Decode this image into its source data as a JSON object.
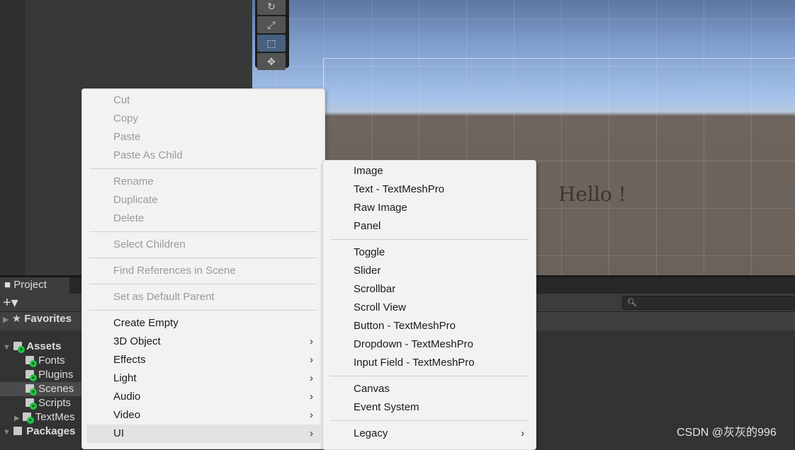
{
  "scene": {
    "canvas_text": "Hello !"
  },
  "project_tab": {
    "label": "Project",
    "add_label": "+▾",
    "search_placeholder": ""
  },
  "tree": [
    {
      "label": "Favorites",
      "kind": "root",
      "icon": "star-icon"
    },
    {
      "label": "Assets",
      "kind": "root",
      "icon": "folder-icon"
    },
    {
      "label": "Fonts",
      "kind": "child"
    },
    {
      "label": "Plugins",
      "kind": "child"
    },
    {
      "label": "Scenes",
      "kind": "child",
      "selected": true
    },
    {
      "label": "Scripts",
      "kind": "child"
    },
    {
      "label": "TextMes",
      "kind": "child"
    },
    {
      "label": "Packages",
      "kind": "root",
      "icon": "folder-icon"
    }
  ],
  "context_menu": [
    {
      "label": "Cut",
      "disabled": true
    },
    {
      "label": "Copy",
      "disabled": true
    },
    {
      "label": "Paste",
      "disabled": true
    },
    {
      "label": "Paste As Child",
      "disabled": true
    },
    {
      "sep": true
    },
    {
      "label": "Rename",
      "disabled": true
    },
    {
      "label": "Duplicate",
      "disabled": true
    },
    {
      "label": "Delete",
      "disabled": true
    },
    {
      "sep": true
    },
    {
      "label": "Select Children",
      "disabled": true
    },
    {
      "sep": true
    },
    {
      "label": "Find References in Scene",
      "disabled": true
    },
    {
      "sep": true
    },
    {
      "label": "Set as Default Parent",
      "disabled": true
    },
    {
      "sep": true
    },
    {
      "label": "Create Empty"
    },
    {
      "label": "3D Object",
      "submenu": true
    },
    {
      "label": "Effects",
      "submenu": true
    },
    {
      "label": "Light",
      "submenu": true
    },
    {
      "label": "Audio",
      "submenu": true
    },
    {
      "label": "Video",
      "submenu": true
    },
    {
      "label": "UI",
      "submenu": true,
      "highlighted": true
    }
  ],
  "ui_submenu": [
    {
      "label": "Image"
    },
    {
      "label": "Text - TextMeshPro"
    },
    {
      "label": "Raw Image"
    },
    {
      "label": "Panel"
    },
    {
      "sep": true
    },
    {
      "label": "Toggle"
    },
    {
      "label": "Slider"
    },
    {
      "label": "Scrollbar"
    },
    {
      "label": "Scroll View"
    },
    {
      "label": "Button - TextMeshPro"
    },
    {
      "label": "Dropdown - TextMeshPro"
    },
    {
      "label": "Input Field - TextMeshPro"
    },
    {
      "sep": true
    },
    {
      "label": "Canvas"
    },
    {
      "label": "Event System"
    },
    {
      "sep": true
    },
    {
      "label": "Legacy",
      "submenu": true
    }
  ],
  "watermark": "CSDN @灰灰的996"
}
